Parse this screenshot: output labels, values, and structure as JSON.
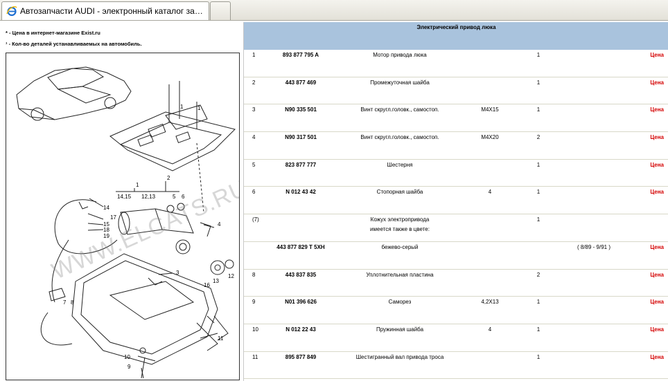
{
  "browser": {
    "tab_title": "Автозапчасти AUDI - электронный каталог запчас..."
  },
  "notes": {
    "line1_sym": "*",
    "line1_text": " - Цена в интернет-магазине Exist.ru",
    "line2_sym": "¹",
    "line2_text": " - Кол-во деталей устанавливаемых на автомобиль."
  },
  "diagram": {
    "watermark": "WWW.ELCATS.RU",
    "labels": {
      "l1": "1",
      "l2": "2",
      "l1415": "14,15",
      "l1213": "12,13",
      "l5": "5",
      "l6": "6",
      "l14": "14",
      "l17": "17",
      "l15": "15",
      "l18": "18",
      "l19": "19",
      "l4": "4",
      "l3": "3",
      "l12": "12",
      "l13": "13",
      "l16": "16",
      "l7": "7",
      "l8": "8",
      "l11": "11",
      "l10": "10",
      "l9": "9",
      "l1a": "1",
      "l1b": "1"
    }
  },
  "parts": {
    "header": "Электрический привод люка",
    "price_label": "Цена",
    "rows": [
      {
        "num": "1",
        "art": "893 877 795 A",
        "name": "Мотор привода люка",
        "name2": "",
        "size": "",
        "qty": "1",
        "date": "",
        "price": true
      },
      {
        "num": "2",
        "art": "443 877 469",
        "name": "Промежуточная шайба",
        "name2": "",
        "size": "",
        "qty": "1",
        "date": "",
        "price": true
      },
      {
        "num": "3",
        "art": "N90 335 501",
        "name": "Винт скругл.головк., самостоп.",
        "name2": "",
        "size": "M4X15",
        "qty": "1",
        "date": "",
        "price": true
      },
      {
        "num": "4",
        "art": "N90 317 501",
        "name": "Винт скругл.головк., самостоп.",
        "name2": "",
        "size": "M4X20",
        "qty": "2",
        "date": "",
        "price": true
      },
      {
        "num": "5",
        "art": "823 877 777",
        "name": "Шестерня",
        "name2": "",
        "size": "",
        "qty": "1",
        "date": "",
        "price": true
      },
      {
        "num": "6",
        "art": "N 012 43 42",
        "name": "Стопорная шайба",
        "name2": "",
        "size": "4",
        "qty": "1",
        "date": "",
        "price": true
      },
      {
        "num": "(7)",
        "art": "",
        "name": "Кожух электропривода",
        "name2": "имеется также в цвете:",
        "size": "",
        "qty": "1",
        "date": "",
        "price": false
      },
      {
        "num": "",
        "art": "443 877 829 T 5XH",
        "name": "бежево-серый",
        "name2": "",
        "size": "",
        "qty": "",
        "date": "( 8/89 - 9/91 )",
        "price": true
      },
      {
        "num": "8",
        "art": "443 837 835",
        "name": "Уплотнительная пластина",
        "name2": "",
        "size": "",
        "qty": "2",
        "date": "",
        "price": true
      },
      {
        "num": "9",
        "art": "N01 396 626",
        "name": "Саморез",
        "name2": "",
        "size": "4,2X13",
        "qty": "1",
        "date": "",
        "price": true
      },
      {
        "num": "10",
        "art": "N 012 22 43",
        "name": "Пружинная шайба",
        "name2": "",
        "size": "4",
        "qty": "1",
        "date": "",
        "price": true
      },
      {
        "num": "11",
        "art": "895 877 849",
        "name": "Шестигранный вал привода троса",
        "name2": "",
        "size": "",
        "qty": "1",
        "date": "",
        "price": true
      }
    ]
  }
}
